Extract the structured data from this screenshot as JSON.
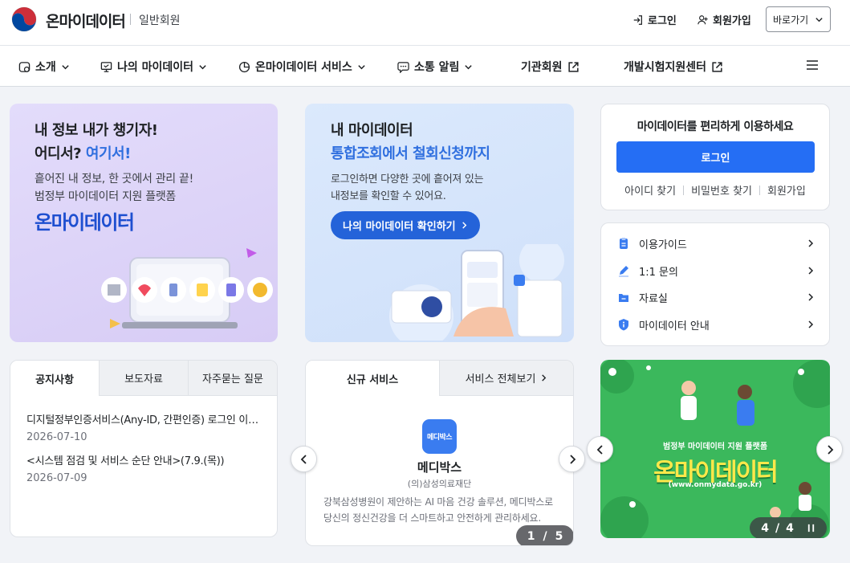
{
  "header": {
    "brand": "온마이데이터",
    "sub": "일반회원",
    "login": "로그인",
    "signup": "회원가입",
    "goto": "바로가기"
  },
  "nav": {
    "items": [
      "소개",
      "나의 마이데이터",
      "온마이데이터 서비스",
      "소통 알림",
      "기관회원",
      "개발시험지원센터"
    ]
  },
  "hero1": {
    "line1": "내 정보 내가 챙기자!",
    "line2_a": "어디서?",
    "line2_b": "여기서!",
    "desc1": "흩어진 내 정보, 한 곳에서 관리 끝!",
    "desc2": "범정부 마이데이터 지원 플랫폼",
    "logo_text": "온마이데이터"
  },
  "hero2": {
    "line1": "내 마이데이터",
    "line2": "통합조회에서 철회신청까지",
    "desc1": "로그인하면 다양한 곳에 흩어져 있는",
    "desc2": "내정보를 확인할 수 있어요.",
    "cta": "나의 마이데이터 확인하기"
  },
  "login_card": {
    "title": "마이데이터를 편리하게 이용하세요",
    "button": "로그인",
    "find_id": "아이디 찾기",
    "find_pw": "비밀번호 찾기",
    "signup": "회원가입"
  },
  "quick_menu": [
    "이용가이드",
    "1:1 문의",
    "자료실",
    "마이데이터 안내"
  ],
  "notice": {
    "tabs": [
      "공지사항",
      "보도자료",
      "자주묻는 질문"
    ],
    "items": [
      {
        "title": "디지털정부인증서비스(Any-ID, 간편인증) 로그인 이…",
        "date": "2026-07-10"
      },
      {
        "title": "<시스템 점검 및 서비스 순단 안내>(7.9.(목))",
        "date": "2026-07-09"
      }
    ]
  },
  "service": {
    "tabs": [
      "신규 서비스",
      "서비스 전체보기"
    ],
    "logo_text": "메디박스",
    "name": "메디박스",
    "org": "(의)삼성의료재단",
    "desc": "강북삼성병원이 제안하는 AI 마음 건강 솔루션, 메디박스로 당신의 정신건강을 더 스마트하고 안전하게 관리하세요.",
    "pager_current": "1",
    "pager_sep": "/",
    "pager_total": "5"
  },
  "banner": {
    "small": "범정부 마이데이터 지원 플랫폼",
    "big": "온마이데이터",
    "url": "(www.onmydata.go.kr)",
    "pager_current": "4",
    "pager_sep": "/",
    "pager_total": "4"
  },
  "colors": {
    "primary": "#256ef4",
    "accent": "#2f6fdf",
    "hero1_bg": "#ddd4f9",
    "hero2_bg": "#d6e5fb",
    "banner_bg": "#3bb85c"
  }
}
